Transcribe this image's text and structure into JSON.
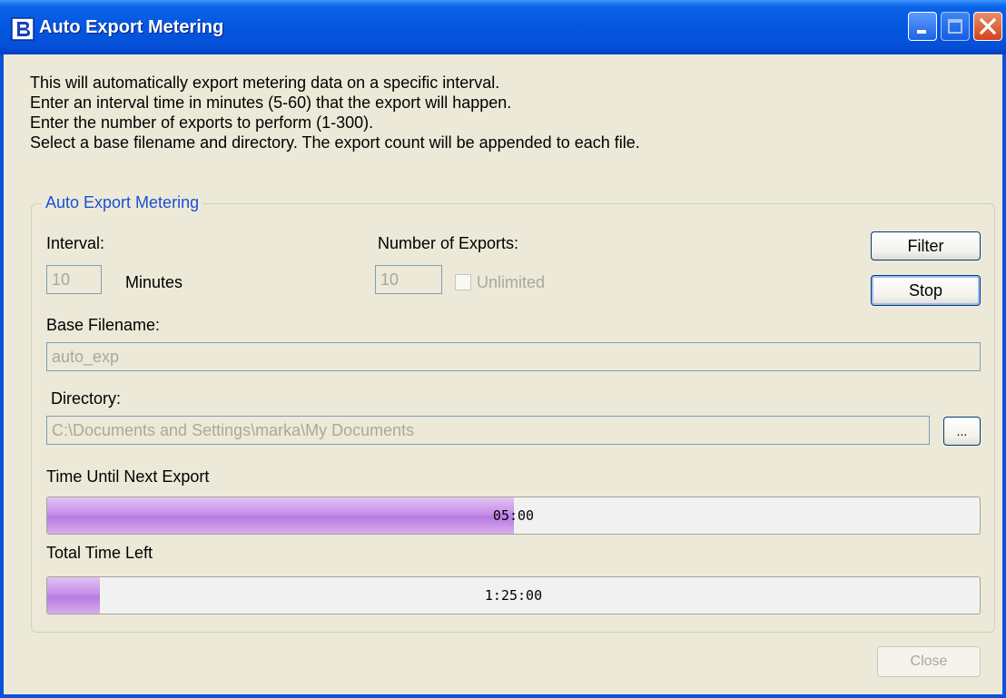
{
  "window": {
    "title": "Auto Export Metering",
    "icons": {
      "app": "app-b-icon",
      "minimize": "minimize-icon",
      "maximize": "maximize-icon",
      "close": "close-icon"
    }
  },
  "instructions": [
    "This will automatically export metering data on a specific interval.",
    "Enter an interval time in minutes (5-60) that the export will happen.",
    "Enter the number of exports to perform (1-300).",
    "Select a base filename and directory. The export count will be appended to each file."
  ],
  "group": {
    "title": "Auto Export Metering",
    "interval_label": "Interval:",
    "interval_value": "10",
    "minutes_label": "Minutes",
    "exports_label": "Number of Exports:",
    "exports_value": "10",
    "unlimited_label": "Unlimited",
    "unlimited_checked": false,
    "filter_button": "Filter",
    "stop_button": "Stop",
    "base_filename_label": "Base Filename:",
    "base_filename_value": "auto_exp",
    "directory_label": "Directory:",
    "directory_value": "C:\\Documents and Settings\\marka\\My Documents",
    "browse_button": "...",
    "next_export_label": "Time Until Next Export",
    "next_export_text": "05:00",
    "next_export_fraction": 0.5,
    "total_left_label": "Total Time Left",
    "total_left_text": "1:25:00",
    "total_left_fraction": 0.056
  },
  "footer": {
    "close_button": "Close"
  },
  "colors": {
    "title_bar": "#0550d8",
    "progress_fill": "#c58fe8",
    "group_title": "#1c4fd6",
    "window_bg": "#ece9d8"
  }
}
